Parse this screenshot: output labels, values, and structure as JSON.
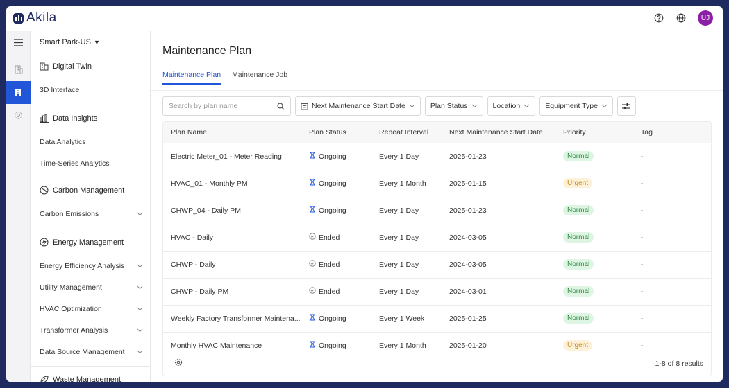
{
  "app": {
    "name": "Akila",
    "avatar_initials": "UJ",
    "accent": "#2156d9",
    "avatar_color": "#8b1fa6"
  },
  "topbar_icons": [
    "help-icon",
    "globe-icon"
  ],
  "rail": [
    "menu-icon",
    "building-icon",
    "building-active-icon",
    "settings-icon"
  ],
  "menu": {
    "site": "Smart Park-US",
    "groups": [
      {
        "title": "Digital Twin",
        "icon": "digital-twin-icon",
        "items": [
          {
            "label": "3D Interface",
            "chevron": false
          }
        ]
      },
      {
        "title": "Data Insights",
        "icon": "chart-icon",
        "items": [
          {
            "label": "Data Analytics",
            "chevron": false
          },
          {
            "label": "Time-Series Analytics",
            "chevron": false
          }
        ]
      },
      {
        "title": "Carbon Management",
        "icon": "globe-leaf-icon",
        "items": [
          {
            "label": "Carbon Emissions",
            "chevron": true
          }
        ]
      },
      {
        "title": "Energy Management",
        "icon": "energy-icon",
        "items": [
          {
            "label": "Energy Efficiency Analysis",
            "chevron": true
          },
          {
            "label": "Utility Management",
            "chevron": true
          },
          {
            "label": "HVAC Optimization",
            "chevron": true
          },
          {
            "label": "Transformer Analysis",
            "chevron": true
          },
          {
            "label": "Data Source Management",
            "chevron": true
          }
        ]
      },
      {
        "title": "Waste Management",
        "icon": "leaf-icon",
        "items": []
      }
    ]
  },
  "page": {
    "title": "Maintenance Plan",
    "tabs": [
      "Maintenance Plan",
      "Maintenance Job"
    ],
    "search_placeholder": "Search by plan name",
    "filters": {
      "next_date": "Next Maintenance Start Date",
      "plan_status": "Plan Status",
      "location": "Location",
      "equipment_type": "Equipment Type"
    },
    "columns": [
      "Plan Name",
      "Plan Status",
      "Repeat Interval",
      "Next Maintenance Start Date",
      "Priority",
      "Tag"
    ],
    "rows": [
      {
        "name": "Electric Meter_01 - Meter Reading",
        "status": "Ongoing",
        "interval": "Every 1 Day",
        "date": "2025-01-23",
        "priority": "Normal",
        "tag": "-"
      },
      {
        "name": "HVAC_01 - Monthly PM",
        "status": "Ongoing",
        "interval": "Every 1 Month",
        "date": "2025-01-15",
        "priority": "Urgent",
        "tag": "-"
      },
      {
        "name": "CHWP_04 - Daily PM",
        "status": "Ongoing",
        "interval": "Every 1 Day",
        "date": "2025-01-23",
        "priority": "Normal",
        "tag": "-"
      },
      {
        "name": "HVAC - Daily",
        "status": "Ended",
        "interval": "Every 1 Day",
        "date": "2024-03-05",
        "priority": "Normal",
        "tag": "-"
      },
      {
        "name": "CHWP - Daily",
        "status": "Ended",
        "interval": "Every 1 Day",
        "date": "2024-03-05",
        "priority": "Normal",
        "tag": "-"
      },
      {
        "name": "CHWP - Daily PM",
        "status": "Ended",
        "interval": "Every 1 Day",
        "date": "2024-03-01",
        "priority": "Normal",
        "tag": "-"
      },
      {
        "name": "Weekly Factory Transformer Maintena...",
        "status": "Ongoing",
        "interval": "Every 1 Week",
        "date": "2025-01-25",
        "priority": "Normal",
        "tag": "-"
      },
      {
        "name": "Monthly HVAC Maintenance",
        "status": "Ongoing",
        "interval": "Every 1 Month",
        "date": "2025-01-20",
        "priority": "Urgent",
        "tag": "-"
      }
    ],
    "results": "1-8 of 8 results"
  }
}
